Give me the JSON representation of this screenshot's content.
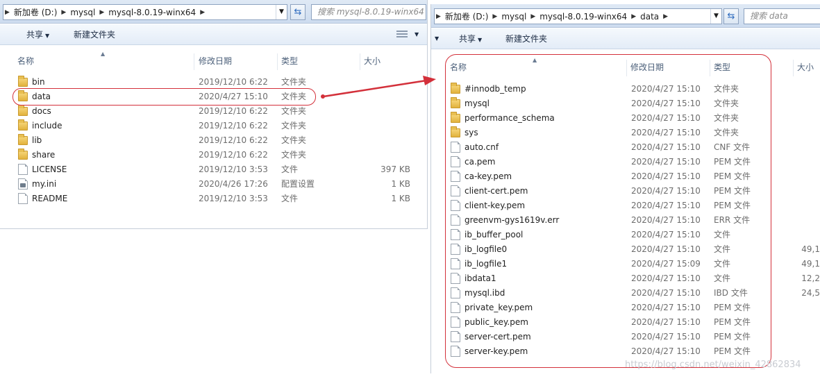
{
  "left": {
    "address": [
      "新加卷 (D:)",
      "mysql",
      "mysql-8.0.19-winx64"
    ],
    "search_placeholder": "搜索 mysql-8.0.19-winx64",
    "toolbar": {
      "share": "共享",
      "new_folder": "新建文件夹"
    },
    "columns": {
      "name": "名称",
      "modified": "修改日期",
      "type": "类型",
      "size": "大小"
    },
    "rows": [
      {
        "name": "bin",
        "modified": "2019/12/10 6:22",
        "type": "文件夹",
        "size": "",
        "icon": "folder"
      },
      {
        "name": "data",
        "modified": "2020/4/27 15:10",
        "type": "文件夹",
        "size": "",
        "icon": "folder"
      },
      {
        "name": "docs",
        "modified": "2019/12/10 6:22",
        "type": "文件夹",
        "size": "",
        "icon": "folder"
      },
      {
        "name": "include",
        "modified": "2019/12/10 6:22",
        "type": "文件夹",
        "size": "",
        "icon": "folder"
      },
      {
        "name": "lib",
        "modified": "2019/12/10 6:22",
        "type": "文件夹",
        "size": "",
        "icon": "folder"
      },
      {
        "name": "share",
        "modified": "2019/12/10 6:22",
        "type": "文件夹",
        "size": "",
        "icon": "folder"
      },
      {
        "name": "LICENSE",
        "modified": "2019/12/10 3:53",
        "type": "文件",
        "size": "397 KB",
        "icon": "file"
      },
      {
        "name": "my.ini",
        "modified": "2020/4/26 17:26",
        "type": "配置设置",
        "size": "1 KB",
        "icon": "settings"
      },
      {
        "name": "README",
        "modified": "2019/12/10 3:53",
        "type": "文件",
        "size": "1 KB",
        "icon": "file"
      }
    ]
  },
  "right": {
    "address": [
      "新加卷 (D:)",
      "mysql",
      "mysql-8.0.19-winx64",
      "data"
    ],
    "search_placeholder": "搜索 data",
    "toolbar": {
      "share": "共享",
      "new_folder": "新建文件夹"
    },
    "columns": {
      "name": "名称",
      "modified": "修改日期",
      "type": "类型",
      "size": "大小"
    },
    "rows": [
      {
        "name": "#innodb_temp",
        "modified": "2020/4/27 15:10",
        "type": "文件夹",
        "size": "",
        "icon": "folder"
      },
      {
        "name": "mysql",
        "modified": "2020/4/27 15:10",
        "type": "文件夹",
        "size": "",
        "icon": "folder"
      },
      {
        "name": "performance_schema",
        "modified": "2020/4/27 15:10",
        "type": "文件夹",
        "size": "",
        "icon": "folder"
      },
      {
        "name": "sys",
        "modified": "2020/4/27 15:10",
        "type": "文件夹",
        "size": "",
        "icon": "folder"
      },
      {
        "name": "auto.cnf",
        "modified": "2020/4/27 15:10",
        "type": "CNF 文件",
        "size": "",
        "icon": "file"
      },
      {
        "name": "ca.pem",
        "modified": "2020/4/27 15:10",
        "type": "PEM 文件",
        "size": "",
        "icon": "file"
      },
      {
        "name": "ca-key.pem",
        "modified": "2020/4/27 15:10",
        "type": "PEM 文件",
        "size": "",
        "icon": "file"
      },
      {
        "name": "client-cert.pem",
        "modified": "2020/4/27 15:10",
        "type": "PEM 文件",
        "size": "",
        "icon": "file"
      },
      {
        "name": "client-key.pem",
        "modified": "2020/4/27 15:10",
        "type": "PEM 文件",
        "size": "",
        "icon": "file"
      },
      {
        "name": "greenvm-gys1619v.err",
        "modified": "2020/4/27 15:10",
        "type": "ERR 文件",
        "size": "",
        "icon": "file"
      },
      {
        "name": "ib_buffer_pool",
        "modified": "2020/4/27 15:10",
        "type": "文件",
        "size": "",
        "icon": "file"
      },
      {
        "name": "ib_logfile0",
        "modified": "2020/4/27 15:10",
        "type": "文件",
        "size": "49,1",
        "icon": "file"
      },
      {
        "name": "ib_logfile1",
        "modified": "2020/4/27 15:09",
        "type": "文件",
        "size": "49,1",
        "icon": "file"
      },
      {
        "name": "ibdata1",
        "modified": "2020/4/27 15:10",
        "type": "文件",
        "size": "12,2",
        "icon": "file"
      },
      {
        "name": "mysql.ibd",
        "modified": "2020/4/27 15:10",
        "type": "IBD 文件",
        "size": "24,5",
        "icon": "file"
      },
      {
        "name": "private_key.pem",
        "modified": "2020/4/27 15:10",
        "type": "PEM 文件",
        "size": "",
        "icon": "file"
      },
      {
        "name": "public_key.pem",
        "modified": "2020/4/27 15:10",
        "type": "PEM 文件",
        "size": "",
        "icon": "file"
      },
      {
        "name": "server-cert.pem",
        "modified": "2020/4/27 15:10",
        "type": "PEM 文件",
        "size": "",
        "icon": "file"
      },
      {
        "name": "server-key.pem",
        "modified": "2020/4/27 15:10",
        "type": "PEM 文件",
        "size": "",
        "icon": "file"
      }
    ]
  },
  "watermark": "https://blog.csdn.net/weixin_42862834",
  "colors": {
    "highlight": "#d3303a",
    "folder": "#e2b23d",
    "chrome": "#dbe6f3"
  }
}
